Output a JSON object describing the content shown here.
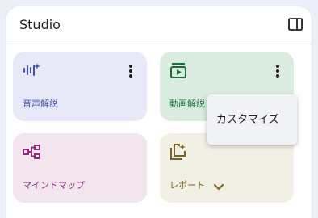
{
  "header": {
    "title": "Studio"
  },
  "cards": {
    "audio": {
      "label": "音声解説",
      "color": "#3f51b5"
    },
    "video": {
      "label": "動画解説",
      "color": "#1b6e3a"
    },
    "mindmap": {
      "label": "マインドマップ",
      "color": "#8e2a7f"
    },
    "report": {
      "label": "レポート",
      "color": "#7a6520"
    }
  },
  "menu": {
    "customize_label": "カスタマイズ"
  }
}
